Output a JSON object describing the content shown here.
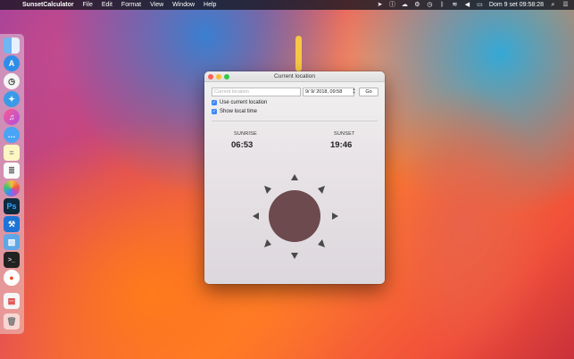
{
  "menubar": {
    "apple_icon": "apple-icon",
    "app_name": "SunsetCalculator",
    "menus": [
      "File",
      "Edit",
      "Format",
      "View",
      "Window",
      "Help"
    ],
    "clock": "Dom 9 set  09:58:28"
  },
  "dock": {
    "icons": [
      "finder-icon",
      "app-store-icon",
      "clock-icon",
      "safari-icon",
      "itunes-icon",
      "messages-icon",
      "notes-icon",
      "textedit-icon",
      "photos-icon",
      "photoshop-icon",
      "xcode-icon",
      "preview-icon",
      "terminal-icon",
      "sunset-calculator-icon",
      "pages-icon",
      "trash-icon"
    ],
    "photoshop_label": "Ps"
  },
  "window": {
    "title": "Current location",
    "location_placeholder": "Current location",
    "date_value": "9/ 9/ 2018, 09:58",
    "go_label": "Go",
    "use_current_location_label": "Use current location",
    "show_local_time_label": "Show local time",
    "sunrise_label": "SUNRISE",
    "sunrise_time": "06:53",
    "sunset_label": "SUNSET",
    "sunset_time": "19:46"
  },
  "colors": {
    "accent": "#3b86f7",
    "sun": "#6d4a4e",
    "rays": "#4a4a4a"
  }
}
